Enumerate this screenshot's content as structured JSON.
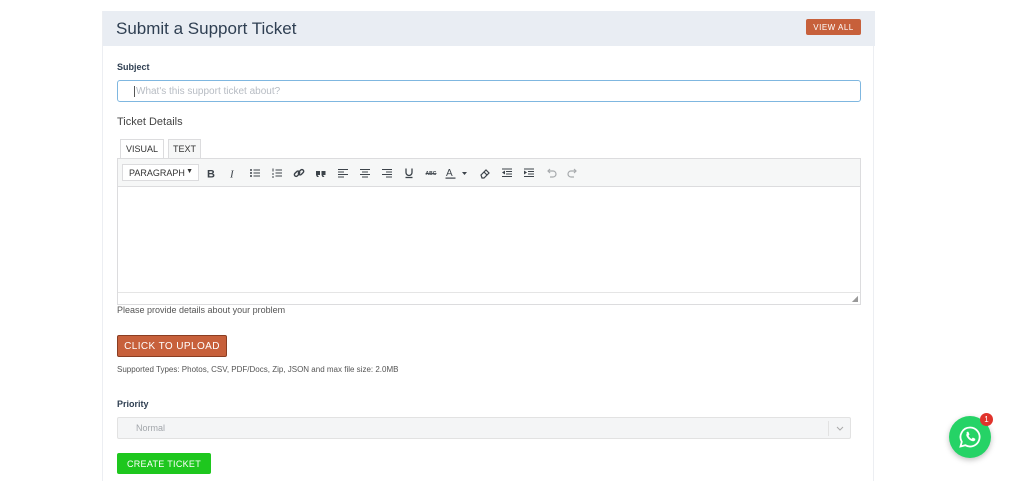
{
  "header": {
    "title": "Submit a Support Ticket",
    "view_all_label": "VIEW ALL"
  },
  "form": {
    "subject_label": "Subject",
    "subject_placeholder": "What's this support ticket about?",
    "subject_value": "",
    "details_label": "Ticket Details",
    "editor_tabs": [
      {
        "label": "VISUAL",
        "active": true
      },
      {
        "label": "TEXT",
        "active": false
      }
    ],
    "format_select_value": "PARAGRAPH",
    "toolbar_icons": [
      "bold-icon",
      "italic-icon",
      "bullet-list-icon",
      "numbered-list-icon",
      "link-icon",
      "blockquote-icon",
      "align-left-icon",
      "align-center-icon",
      "align-right-icon",
      "underline-icon",
      "strikethrough-icon",
      "text-color-icon",
      "clear-formatting-icon",
      "outdent-icon",
      "indent-icon",
      "undo-icon",
      "redo-icon"
    ],
    "details_help": "Please provide details about your problem",
    "upload_label": "CLICK TO UPLOAD",
    "supported_types": "Supported Types: Photos, CSV, PDF/Docs, Zip, JSON and max file size: 2.0MB",
    "priority_label": "Priority",
    "priority_value": "Normal",
    "create_label": "CREATE TICKET"
  },
  "chat_widget": {
    "icon": "whatsapp-icon",
    "badge_count": "1"
  },
  "colors": {
    "accent": "#c7603b",
    "success": "#1ec71e",
    "whatsapp": "#25d366",
    "header_bg": "#e9edf3"
  }
}
